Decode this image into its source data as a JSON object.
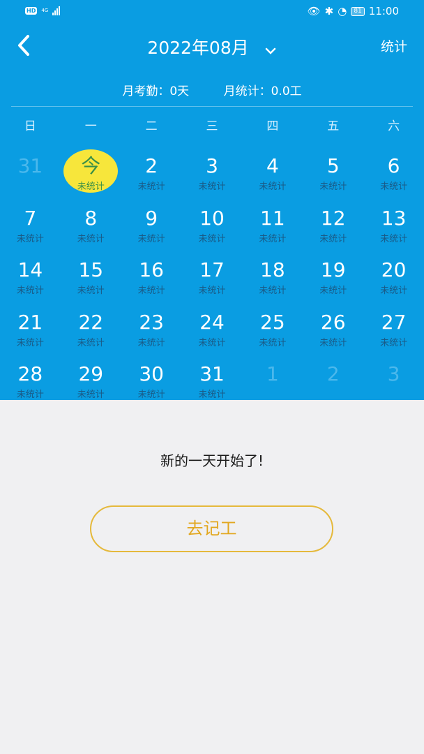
{
  "status_bar": {
    "hd_label": "HD",
    "network": "4G",
    "battery": "81",
    "time": "11:00"
  },
  "header": {
    "title": "2022年08月",
    "stats_button": "统计"
  },
  "summary": {
    "attendance": "月考勤：0天",
    "stats": "月统计：0.0工"
  },
  "weekdays": [
    "日",
    "一",
    "二",
    "三",
    "四",
    "五",
    "六"
  ],
  "calendar": {
    "rows": [
      [
        {
          "num": "31",
          "sub": "",
          "other": true
        },
        {
          "num": "今",
          "sub": "未统计",
          "today": true
        },
        {
          "num": "2",
          "sub": "未统计"
        },
        {
          "num": "3",
          "sub": "未统计"
        },
        {
          "num": "4",
          "sub": "未统计"
        },
        {
          "num": "5",
          "sub": "未统计"
        },
        {
          "num": "6",
          "sub": "未统计"
        }
      ],
      [
        {
          "num": "7",
          "sub": "未统计"
        },
        {
          "num": "8",
          "sub": "未统计"
        },
        {
          "num": "9",
          "sub": "未统计"
        },
        {
          "num": "10",
          "sub": "未统计"
        },
        {
          "num": "11",
          "sub": "未统计"
        },
        {
          "num": "12",
          "sub": "未统计"
        },
        {
          "num": "13",
          "sub": "未统计"
        }
      ],
      [
        {
          "num": "14",
          "sub": "未统计"
        },
        {
          "num": "15",
          "sub": "未统计"
        },
        {
          "num": "16",
          "sub": "未统计"
        },
        {
          "num": "17",
          "sub": "未统计"
        },
        {
          "num": "18",
          "sub": "未统计"
        },
        {
          "num": "19",
          "sub": "未统计"
        },
        {
          "num": "20",
          "sub": "未统计"
        }
      ],
      [
        {
          "num": "21",
          "sub": "未统计"
        },
        {
          "num": "22",
          "sub": "未统计"
        },
        {
          "num": "23",
          "sub": "未统计"
        },
        {
          "num": "24",
          "sub": "未统计"
        },
        {
          "num": "25",
          "sub": "未统计"
        },
        {
          "num": "26",
          "sub": "未统计"
        },
        {
          "num": "27",
          "sub": "未统计"
        }
      ],
      [
        {
          "num": "28",
          "sub": "未统计"
        },
        {
          "num": "29",
          "sub": "未统计"
        },
        {
          "num": "30",
          "sub": "未统计"
        },
        {
          "num": "31",
          "sub": "未统计"
        },
        {
          "num": "1",
          "sub": "",
          "other": true
        },
        {
          "num": "2",
          "sub": "",
          "other": true
        },
        {
          "num": "3",
          "sub": "",
          "other": true
        }
      ]
    ]
  },
  "content": {
    "message": "新的一天开始了!",
    "button_label": "去记工"
  },
  "colors": {
    "primary": "#0a9de2",
    "today_highlight": "#f7e63b",
    "accent_button": "#e2a71f"
  }
}
